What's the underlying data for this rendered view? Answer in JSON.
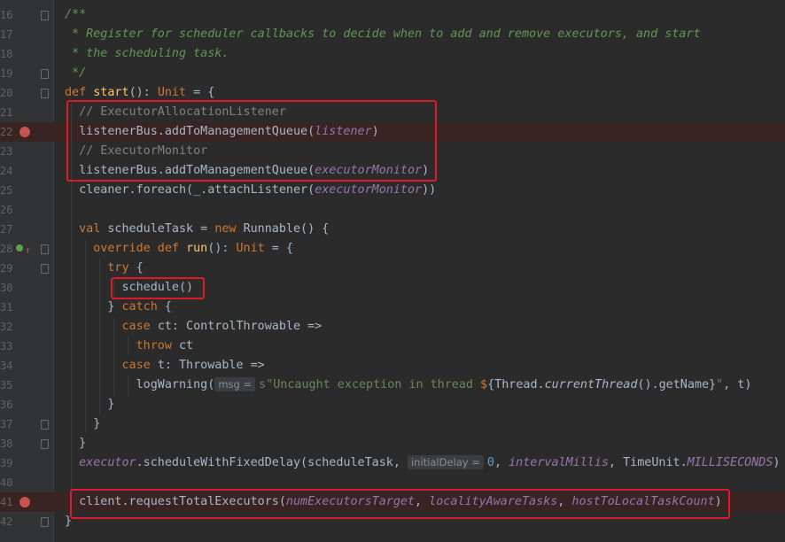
{
  "editor": {
    "lines": [
      {
        "n": "16",
        "tokens": [
          [
            "dc",
            "/**"
          ]
        ]
      },
      {
        "n": "17",
        "tokens": [
          [
            "dc",
            " * Register for scheduler callbacks to decide when to add and remove executors, and start"
          ]
        ]
      },
      {
        "n": "18",
        "tokens": [
          [
            "dc",
            " * the scheduling task."
          ]
        ]
      },
      {
        "n": "19",
        "tokens": [
          [
            "dc",
            " */"
          ]
        ]
      },
      {
        "n": "20",
        "tokens": [
          [
            "kw",
            "def "
          ],
          [
            "fn",
            "start"
          ],
          [
            "ty",
            "(): "
          ],
          [
            "kw",
            "Unit"
          ],
          [
            "ty",
            " = {"
          ]
        ]
      },
      {
        "n": "21",
        "tokens": [
          [
            "ty",
            "  "
          ],
          [
            "cm",
            "// ExecutorAllocationListener"
          ]
        ]
      },
      {
        "n": "22",
        "tokens": [
          [
            "ty",
            "  listenerBus.addToManagementQueue("
          ],
          [
            "it",
            "listener"
          ],
          [
            "ty",
            ")"
          ]
        ]
      },
      {
        "n": "23",
        "tokens": [
          [
            "ty",
            "  "
          ],
          [
            "cm",
            "// ExecutorMonitor"
          ]
        ]
      },
      {
        "n": "24",
        "tokens": [
          [
            "ty",
            "  listenerBus.addToManagementQueue("
          ],
          [
            "it",
            "executorMonitor"
          ],
          [
            "ty",
            ")"
          ]
        ]
      },
      {
        "n": "25",
        "tokens": [
          [
            "ty",
            "  cleaner.foreach(_.attachListener("
          ],
          [
            "it",
            "executorMonitor"
          ],
          [
            "ty",
            "))"
          ]
        ]
      },
      {
        "n": "26",
        "tokens": []
      },
      {
        "n": "27",
        "tokens": [
          [
            "ty",
            "  "
          ],
          [
            "kw",
            "val "
          ],
          [
            "ty",
            "scheduleTask = "
          ],
          [
            "kw",
            "new "
          ],
          [
            "ty",
            "Runnable() {"
          ]
        ]
      },
      {
        "n": "28",
        "tokens": [
          [
            "ty",
            "    "
          ],
          [
            "kw",
            "override def "
          ],
          [
            "fn",
            "run"
          ],
          [
            "ty",
            "(): "
          ],
          [
            "kw",
            "Unit"
          ],
          [
            "ty",
            " = {"
          ]
        ]
      },
      {
        "n": "29",
        "tokens": [
          [
            "ty",
            "      "
          ],
          [
            "kw",
            "try"
          ],
          [
            "ty",
            " {"
          ]
        ]
      },
      {
        "n": "30",
        "tokens": [
          [
            "ty",
            "        schedule()"
          ]
        ]
      },
      {
        "n": "31",
        "tokens": [
          [
            "ty",
            "      } "
          ],
          [
            "kw",
            "catch"
          ],
          [
            "ty",
            " {"
          ]
        ]
      },
      {
        "n": "32",
        "tokens": [
          [
            "ty",
            "        "
          ],
          [
            "kw",
            "case "
          ],
          [
            "ty",
            "ct: ControlThrowable =>"
          ]
        ]
      },
      {
        "n": "33",
        "tokens": [
          [
            "ty",
            "          "
          ],
          [
            "kw",
            "throw "
          ],
          [
            "ty",
            "ct"
          ]
        ]
      },
      {
        "n": "34",
        "tokens": [
          [
            "ty",
            "        "
          ],
          [
            "kw",
            "case "
          ],
          [
            "ty",
            "t: Throwable =>"
          ]
        ]
      },
      {
        "n": "35",
        "tokens": [
          [
            "ty",
            "          logWarning("
          ],
          [
            "hint",
            "msg ="
          ],
          [
            "st",
            "s\"Uncaught exception in thread "
          ],
          [
            "kw",
            "$"
          ],
          [
            "ty",
            "{Thread."
          ],
          [
            "it2",
            "currentThread"
          ],
          [
            "ty",
            "().getName}"
          ],
          [
            "st",
            "\""
          ],
          [
            "ty",
            ", t)"
          ]
        ]
      },
      {
        "n": "36",
        "tokens": [
          [
            "ty",
            "      }"
          ]
        ]
      },
      {
        "n": "37",
        "tokens": [
          [
            "ty",
            "    }"
          ]
        ]
      },
      {
        "n": "38",
        "tokens": [
          [
            "ty",
            "  }"
          ]
        ]
      },
      {
        "n": "39",
        "tokens": [
          [
            "ty",
            "  "
          ],
          [
            "it",
            "executor"
          ],
          [
            "ty",
            ".scheduleWithFixedDelay(scheduleTask, "
          ],
          [
            "hint",
            "initialDelay ="
          ],
          [
            "nm",
            "0"
          ],
          [
            "ty",
            ", "
          ],
          [
            "it",
            "intervalMillis"
          ],
          [
            "ty",
            ", TimeUnit."
          ],
          [
            "it",
            "MILLISECONDS"
          ],
          [
            "ty",
            ")"
          ]
        ]
      },
      {
        "n": "40",
        "tokens": []
      },
      {
        "n": "41",
        "tokens": [
          [
            "ty",
            "  client.requestTotalExecutors("
          ],
          [
            "it",
            "numExecutorsTarget"
          ],
          [
            "ty",
            ", "
          ],
          [
            "it",
            "localityAwareTasks"
          ],
          [
            "ty",
            ", "
          ],
          [
            "it",
            "hostToLocalTaskCount"
          ],
          [
            "ty",
            ")"
          ]
        ]
      },
      {
        "n": "42",
        "tokens": [
          [
            "ty",
            "}"
          ]
        ]
      }
    ],
    "breakpoint_lines": [
      "22",
      "41"
    ],
    "override_line": "28",
    "colors": {
      "background": "#2b2b2b",
      "keyword": "#cc7832",
      "function": "#ffc66d",
      "comment": "#808080",
      "doc": "#629755",
      "field": "#9876aa",
      "string": "#6a8759",
      "number": "#6897bb",
      "highlight_box": "#e0192a",
      "breakpoint": "#c75450"
    }
  }
}
